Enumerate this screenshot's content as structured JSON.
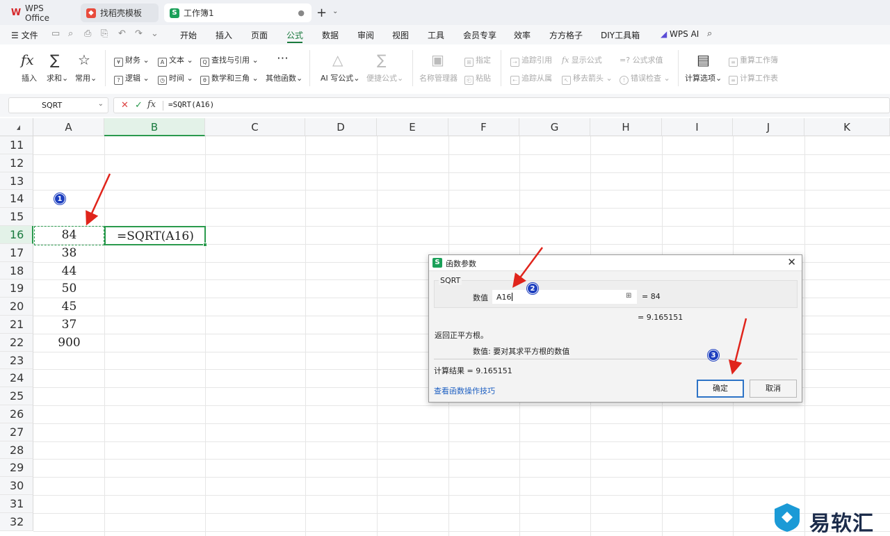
{
  "tabs": {
    "wps": "WPS Office",
    "template": "找稻壳模板",
    "book": "工作簿1"
  },
  "menu": {
    "file": "文件",
    "items": [
      "开始",
      "插入",
      "页面",
      "公式",
      "数据",
      "审阅",
      "视图",
      "工具",
      "会员专享",
      "效率",
      "方方格子",
      "DIY工具箱"
    ],
    "active": "公式",
    "wps_ai": "WPS AI"
  },
  "ribbon": {
    "insert": "插入",
    "autosum": "求和",
    "common": "常用",
    "finance": "财务",
    "logic": "逻辑",
    "text": "文本",
    "time": "时间",
    "lookup": "查找与引用",
    "math": "数学和三角",
    "other": "其他函数",
    "ai_formula": "AI 写公式",
    "quick_formula": "便捷公式",
    "name_manager": "名称管理器",
    "specify": "指定",
    "paste": "粘贴",
    "trace_precedents": "追踪引用",
    "trace_dependents": "追踪从属",
    "show_formulas": "显示公式",
    "remove_arrows": "移去箭头",
    "evaluate": "公式求值",
    "error_check": "错误检查",
    "calc_options": "计算选项",
    "recalc_book": "重算工作簿",
    "calc_sheet": "计算工作表"
  },
  "formula_bar": {
    "name_box": "SQRT",
    "formula": "=SQRT(A16)"
  },
  "grid": {
    "columns": [
      "A",
      "B",
      "C",
      "D",
      "E",
      "F",
      "G",
      "H",
      "I",
      "J",
      "K"
    ],
    "rows": [
      "11",
      "12",
      "13",
      "14",
      "15",
      "16",
      "17",
      "18",
      "19",
      "20",
      "21",
      "22",
      "23",
      "24",
      "25",
      "26",
      "27",
      "28",
      "29",
      "30",
      "31",
      "32"
    ],
    "col_a_values": [
      {
        "row": "16",
        "value": "84"
      },
      {
        "row": "17",
        "value": "38"
      },
      {
        "row": "18",
        "value": "44"
      },
      {
        "row": "19",
        "value": "50"
      },
      {
        "row": "20",
        "value": "45"
      },
      {
        "row": "21",
        "value": "37"
      },
      {
        "row": "22",
        "value": "900"
      }
    ],
    "b16_formula": "=SQRT(A16)"
  },
  "dialog": {
    "title": "函数参数",
    "function_name": "SQRT",
    "arg_label": "数值",
    "arg_value": "A16",
    "arg_eval": "= 84",
    "result_top": "= 9.165151",
    "description": "返回正平方根。",
    "param_desc": "数值:  要对其求平方根的数值",
    "calc_result": "计算结果 = 9.165151",
    "help_link": "查看函数操作技巧",
    "ok": "确定",
    "cancel": "取消"
  },
  "annotations": [
    "1",
    "2",
    "3"
  ],
  "watermark": "易软汇",
  "colors": {
    "accent_green": "#1a7a3e",
    "annotation_red": "#e0241b",
    "badge_blue": "#1d3fbf"
  }
}
